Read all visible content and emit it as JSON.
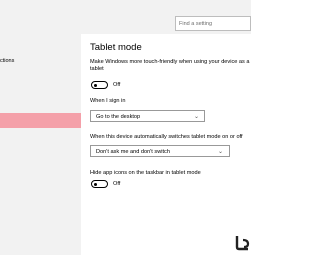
{
  "search": {
    "placeholder": "Find a setting"
  },
  "sidebar": {
    "items": [
      {
        "label": "ctions"
      },
      {
        "label": ""
      }
    ]
  },
  "main": {
    "title": "Tablet mode",
    "touch_friendly": {
      "label_line1": "Make Windows more touch-friendly when using your device as a",
      "label_line2": "tablet",
      "state": "Off"
    },
    "sign_in": {
      "label": "When I sign in",
      "value": "Go to the desktop"
    },
    "auto_switch": {
      "label": "When this device automatically switches tablet mode on or off",
      "value": "Don't ask me and don't switch"
    },
    "hide_icons": {
      "label": "Hide app icons on the taskbar in tablet mode",
      "state": "Off"
    }
  }
}
